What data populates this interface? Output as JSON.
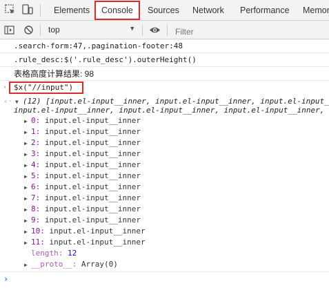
{
  "tabs": [
    {
      "label": "Elements"
    },
    {
      "label": "Console"
    },
    {
      "label": "Sources"
    },
    {
      "label": "Network"
    },
    {
      "label": "Performance"
    },
    {
      "label": "Memor"
    }
  ],
  "toolbar": {
    "context": "top",
    "filter_placeholder": "Filter"
  },
  "console": {
    "log1": ".search-form:47,.pagination-footer:48",
    "log2": ".rule_desc:$('.rule_desc').outerHeight()",
    "log3": "表格高度计算结果: 98",
    "command": "$x(\"//input\")",
    "result_summary_1": "(12) [input.el-input__inner, input.el-input__inner, input.el-input__",
    "result_summary_2": "input.el-input__inner, input.el-input__inner, input.el-input__inner, input.el-input__inner",
    "items": [
      {
        "key": "0",
        "value": "input.el-input__inner"
      },
      {
        "key": "1",
        "value": "input.el-input__inner"
      },
      {
        "key": "2",
        "value": "input.el-input__inner"
      },
      {
        "key": "3",
        "value": "input.el-input__inner"
      },
      {
        "key": "4",
        "value": "input.el-input__inner"
      },
      {
        "key": "5",
        "value": "input.el-input__inner"
      },
      {
        "key": "6",
        "value": "input.el-input__inner"
      },
      {
        "key": "7",
        "value": "input.el-input__inner"
      },
      {
        "key": "8",
        "value": "input.el-input__inner"
      },
      {
        "key": "9",
        "value": "input.el-input__inner"
      },
      {
        "key": "10",
        "value": "input.el-input__inner"
      },
      {
        "key": "11",
        "value": "input.el-input__inner"
      }
    ],
    "length_key": "length",
    "length_value": "12",
    "proto_key": "__proto__",
    "proto_value": "Array(0)"
  }
}
